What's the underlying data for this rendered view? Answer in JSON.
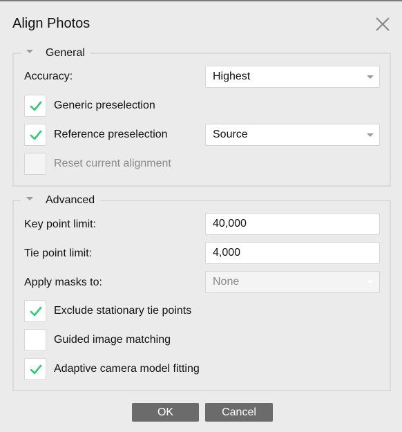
{
  "dialog": {
    "title": "Align Photos",
    "close_icon": "close-icon"
  },
  "general": {
    "legend": "General",
    "collapse_icon": "triangle-down-icon",
    "accuracy": {
      "label": "Accuracy:",
      "value": "Highest"
    },
    "generic_preselection": {
      "label": "Generic preselection",
      "checked": true,
      "enabled": true
    },
    "reference_preselection": {
      "label": "Reference preselection",
      "checked": true,
      "enabled": true,
      "mode_value": "Source"
    },
    "reset_alignment": {
      "label": "Reset current alignment",
      "checked": false,
      "enabled": false
    }
  },
  "advanced": {
    "legend": "Advanced",
    "collapse_icon": "triangle-down-icon",
    "key_point_limit": {
      "label": "Key point limit:",
      "value": "40,000"
    },
    "tie_point_limit": {
      "label": "Tie point limit:",
      "value": "4,000"
    },
    "apply_masks_to": {
      "label": "Apply masks to:",
      "value": "None",
      "enabled": false
    },
    "exclude_stationary": {
      "label": "Exclude stationary tie points",
      "checked": true
    },
    "guided_matching": {
      "label": "Guided image matching",
      "checked": false
    },
    "adaptive_fitting": {
      "label": "Adaptive camera model fitting",
      "checked": true
    }
  },
  "buttons": {
    "ok_label": "OK",
    "cancel_label": "Cancel"
  },
  "colors": {
    "check_mark": "#2ecc71",
    "button_bg": "#6b6b6b",
    "dialog_bg": "#ebebeb"
  }
}
